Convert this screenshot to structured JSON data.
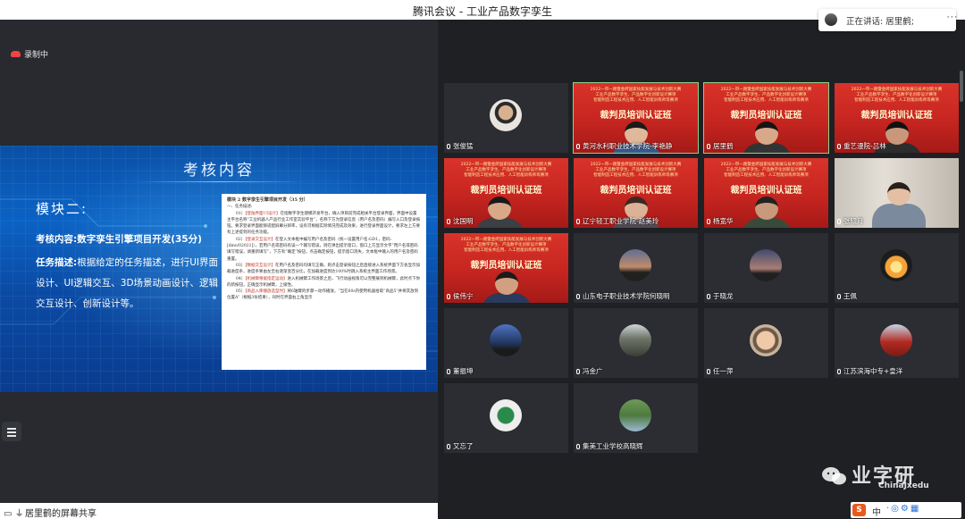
{
  "window": {
    "title": "腾讯会议 - 工业产品数字孪生"
  },
  "speaking": {
    "label": "正在讲话: 居里鹤;"
  },
  "recording": {
    "label": "录制中"
  },
  "slide": {
    "title": "考核内容",
    "module": "模块二:",
    "content_label": "考核内容:",
    "content_text": "数字孪生引擎项目开发(35分)",
    "task_label": "任务描述:",
    "task_text": "根据给定的任务描述，进行UI界面设计、UI逻辑交互、3D场景动画设计、逻辑交互设计、创新设计等。",
    "doc": {
      "title": "模块 2 数字孪生引擎项目开发（35 分）",
      "section": "一、任务描述:",
      "p1_no": "01）",
      "p1_hl": "【登陆界面UI设计】",
      "p1": "在指数字孪生建模开发平台，确入项目前完成相关平台登录界面，界面中设置主平台名称“工业机器人产品行业工作室实验平台”，名称下方为登录信息（用户名及密码）编写入口及登录按钮。要求登录界面能够适配屏幕分辨率，设有可根据实际情况完成及效果，进行登录界面设计，要求左上方要有上述提到的任务功能。",
      "p2_no": "02）",
      "p2_hl": "【登录交互设计】",
      "p2": "在登入文本框中编写用户名及密码（统一设置用户名:GD1，密码:[dmo/02021]），若用户名或密码有误一个输写错误，则在弹出提示窗口，窗口上方显示文字“用户名或密码填写错误，请重新填写”，下方有“确定”按钮，点击确定按钮，提示窗口消失，文本框中输入的用户名及密码重置。",
      "p3_no": "03）",
      "p3_hl": "【数据交互设计】",
      "p3": "在用户名及密码均填写正确，则点击登录按钮之后直接进入系统界面下方会显示加载进度条，进度条要由左至右逐渐变百分比，在加载进度到达100%时跳入系统主界面工作场景。",
      "p4_no": "04）",
      "p4_hl": "【机械臂根据指定运动】",
      "p4": "进入机械臂工作场景之后，飞行动画视角可以完整展到机械臂，此时点下你的新按钮，正确显示机械臂，上级性。",
      "p5_no": "05）",
      "p5_hl": "【商品入库播放选型时】",
      "p5": "将6轴臂的步骤一动作播放，“当在60s内使用机器拾取“商品5”并将其放到位置A”（根据3份结果），同时在界面右上角显示"
    }
  },
  "share_bar": {
    "label": "居里鹤的屏幕共享"
  },
  "banner": {
    "line1": "2022一带一路暨金砖国家技能发展与技术创新大赛",
    "line2": "工业产品数字孪生、产品数字化创新设计赛项",
    "line3": "智能制造工程技术应用、人工智能训练师等赛项",
    "big": "裁判员培训认证班"
  },
  "participants": [
    {
      "name": "张俊猛"
    },
    {
      "name": "黄河水利职业技术学院-李艳静"
    },
    {
      "name": "居里鹤"
    },
    {
      "name": "重艺漫院-吕林"
    },
    {
      "name": "沈国明"
    },
    {
      "name": "辽宁轻工职业学院-赵美玲"
    },
    {
      "name": "杨宽华"
    },
    {
      "name": "张晓月"
    },
    {
      "name": "侯伟宁"
    },
    {
      "name": "山东电子职业技术学院何晓明"
    },
    {
      "name": "于晓龙"
    },
    {
      "name": "王佩"
    },
    {
      "name": "董振坤"
    },
    {
      "name": "冯金广"
    },
    {
      "name": "任一萍"
    },
    {
      "name": "江苏滨海中专+皇洋"
    },
    {
      "name": "又忘了"
    },
    {
      "name": "集美工业学校高晓辉"
    }
  ],
  "watermark": {
    "main": "业字研",
    "sub": "ChinaJxedu"
  },
  "ime": {
    "logo": "S",
    "lang": "中"
  },
  "colors": {
    "active_border": "#8fd18a",
    "banner_red": "#c62520",
    "slide_blue": "#0b62c4"
  }
}
